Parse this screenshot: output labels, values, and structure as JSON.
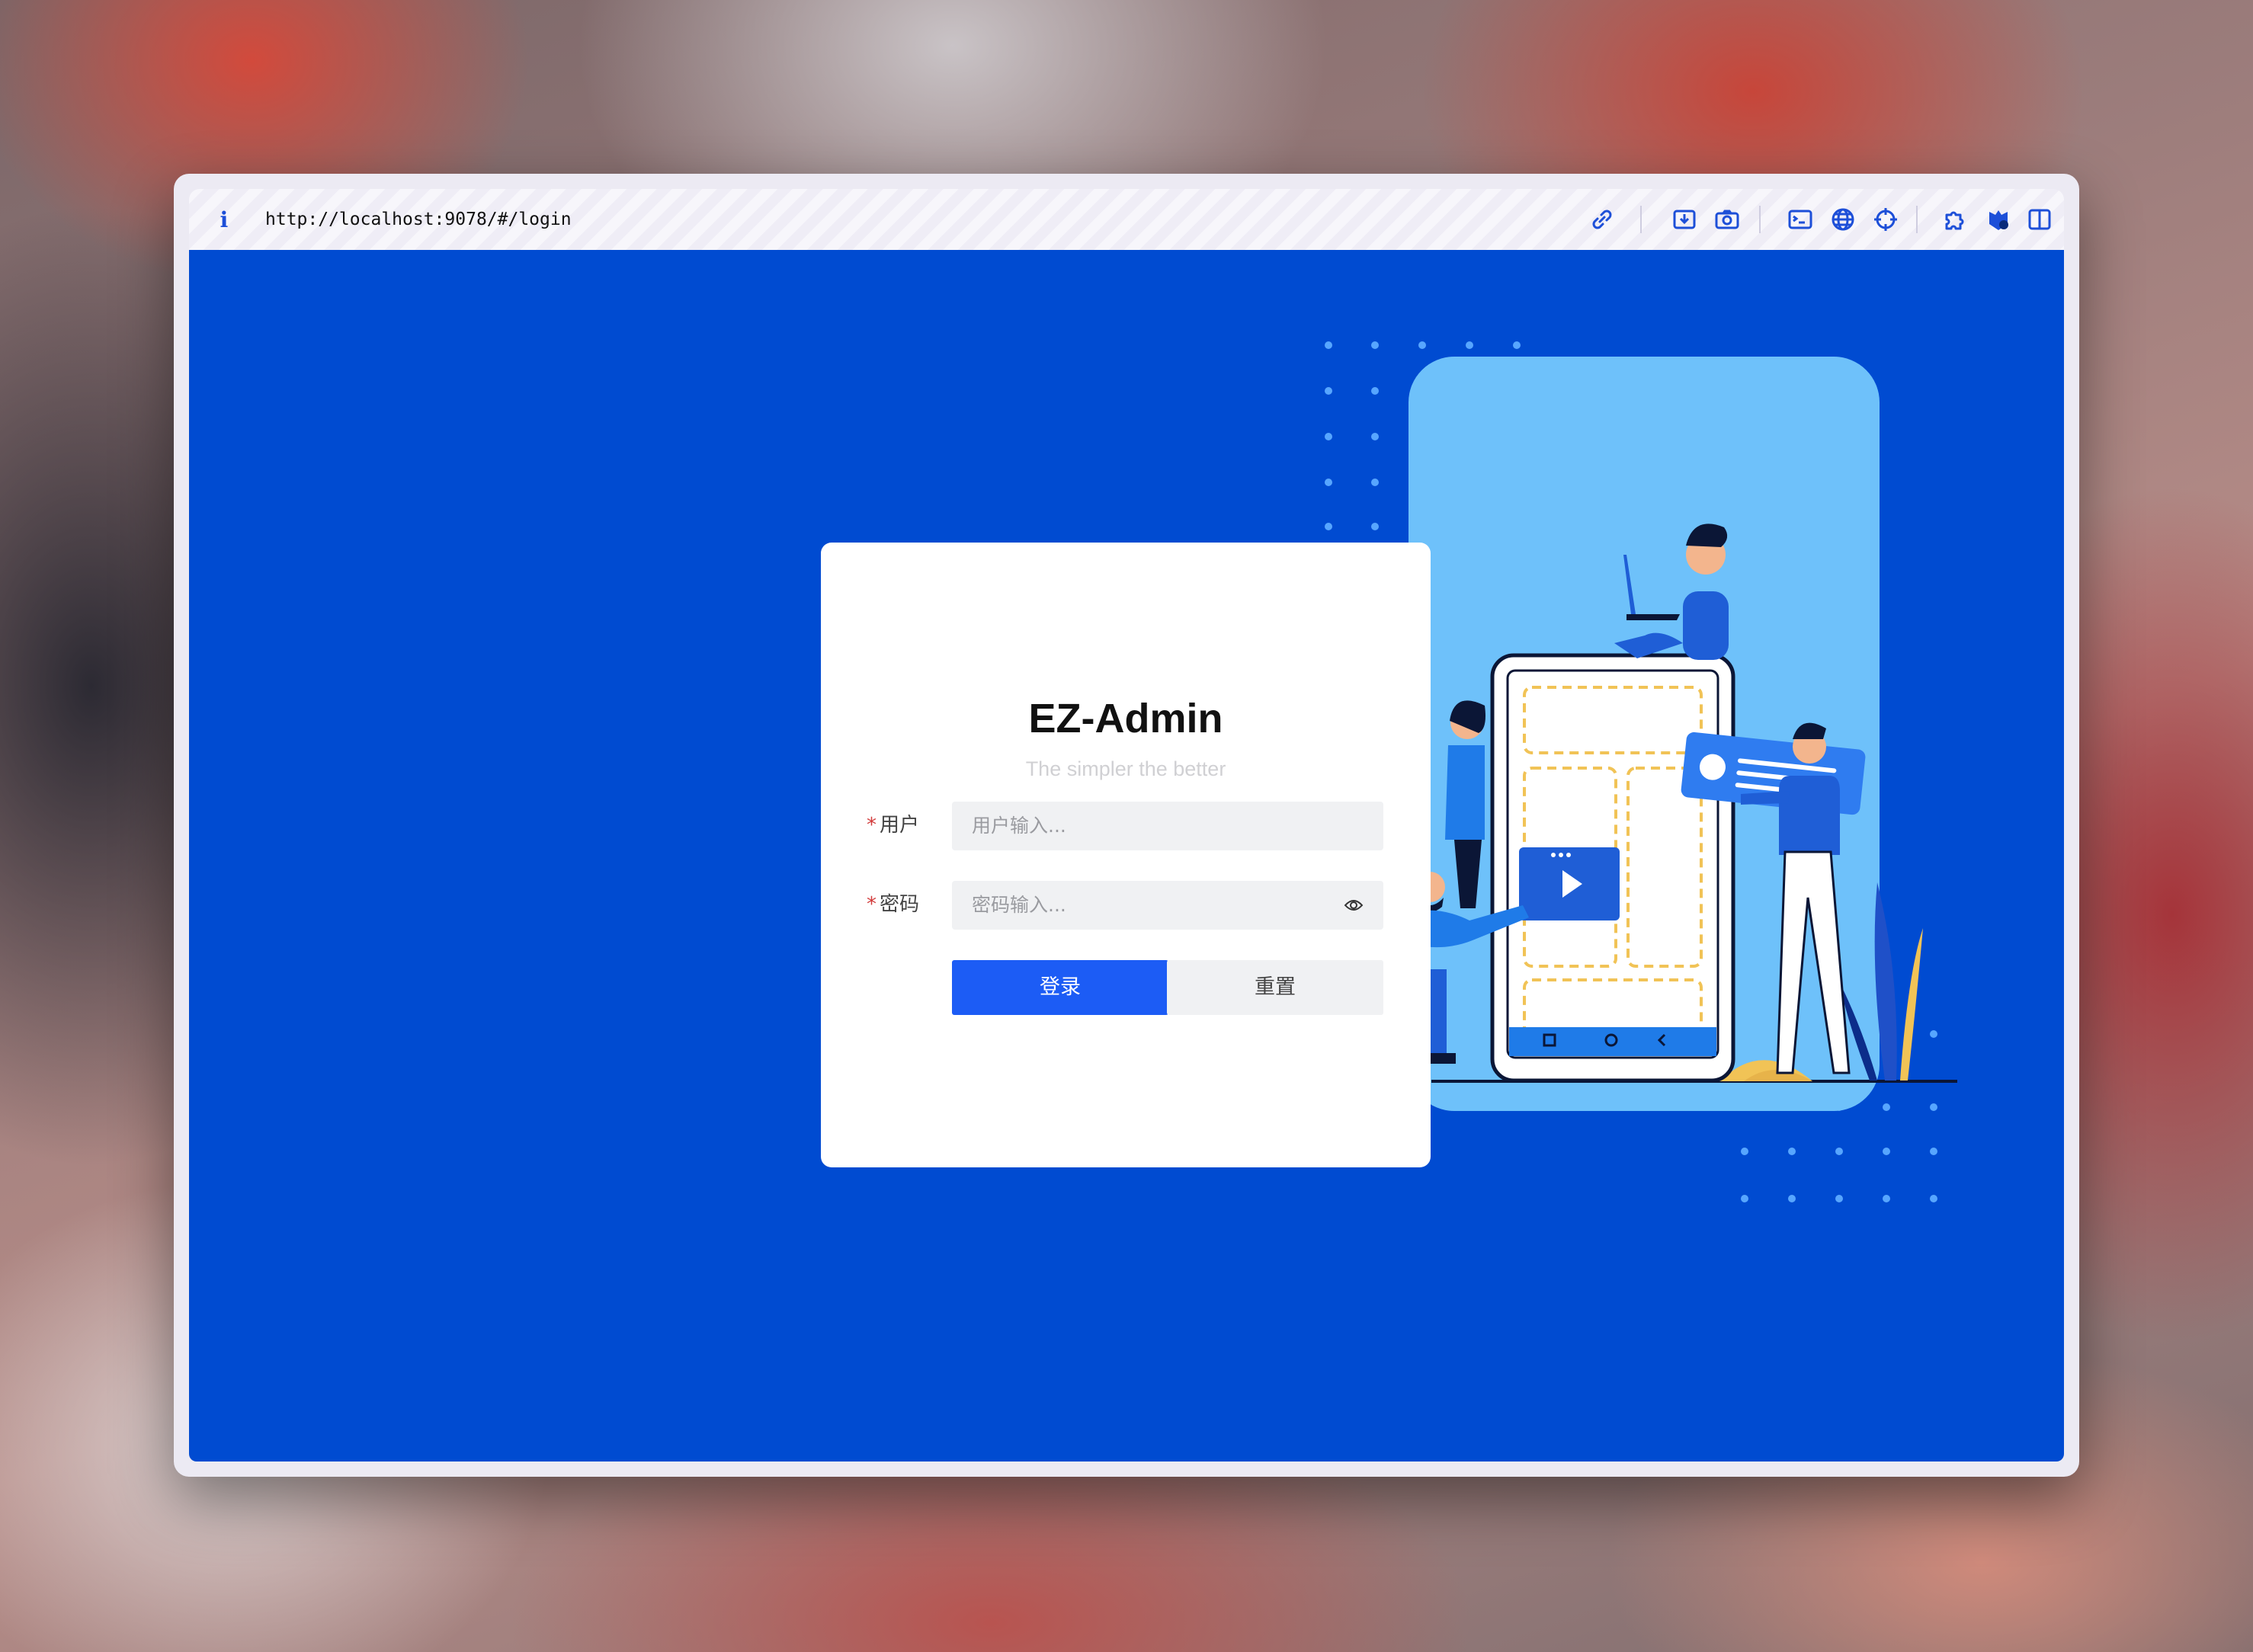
{
  "browser": {
    "url": "http://localhost:9078/#/login",
    "info_icon": "i",
    "toolbar_icons": [
      "link-icon",
      "download-icon",
      "camera-icon",
      "terminal-icon",
      "globe-icon",
      "crosshair-icon",
      "extensions-icon",
      "profile-icon",
      "sidebar-icon"
    ]
  },
  "login": {
    "title": "EZ-Admin",
    "subtitle": "The simpler the better",
    "user_label": "用户",
    "user_placeholder": "用户输入...",
    "password_label": "密码",
    "password_placeholder": "密码输入...",
    "required_mark": "*",
    "login_button": "登录",
    "reset_button": "重置"
  },
  "colors": {
    "page_background": "#004bd1",
    "primary_button": "#1c5cf5",
    "illustration_panel": "#6ec1fa",
    "required_mark": "#d23b3b"
  }
}
